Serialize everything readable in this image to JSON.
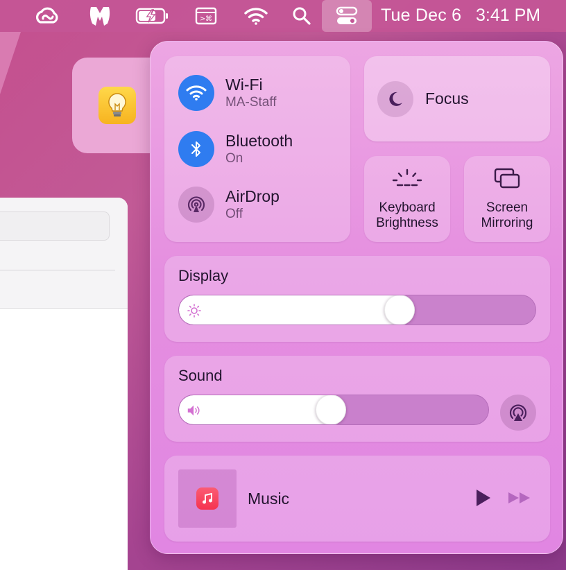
{
  "menubar": {
    "date": "Tue Dec 6",
    "time": "3:41 PM",
    "icons": [
      "creative-cloud-icon",
      "malwarebytes-icon",
      "battery-charging-icon",
      "keyboard-viewer-icon",
      "wifi-icon",
      "spotlight-search-icon",
      "control-center-icon"
    ]
  },
  "control_center": {
    "wifi": {
      "title": "Wi-Fi",
      "subtitle": "MA-Staff"
    },
    "bluetooth": {
      "title": "Bluetooth",
      "subtitle": "On"
    },
    "airdrop": {
      "title": "AirDrop",
      "subtitle": "Off"
    },
    "focus": {
      "label": "Focus"
    },
    "keyboard_brightness": {
      "line1": "Keyboard",
      "line2": "Brightness"
    },
    "screen_mirroring": {
      "line1": "Screen",
      "line2": "Mirroring"
    },
    "display": {
      "title": "Display",
      "level": 0.63
    },
    "sound": {
      "title": "Sound",
      "level": 0.49
    },
    "music": {
      "label": "Music"
    }
  },
  "colors": {
    "accent_blue": "#2f7cf0",
    "panel_pink": "#e58fe0",
    "menubar": "#c45696"
  }
}
